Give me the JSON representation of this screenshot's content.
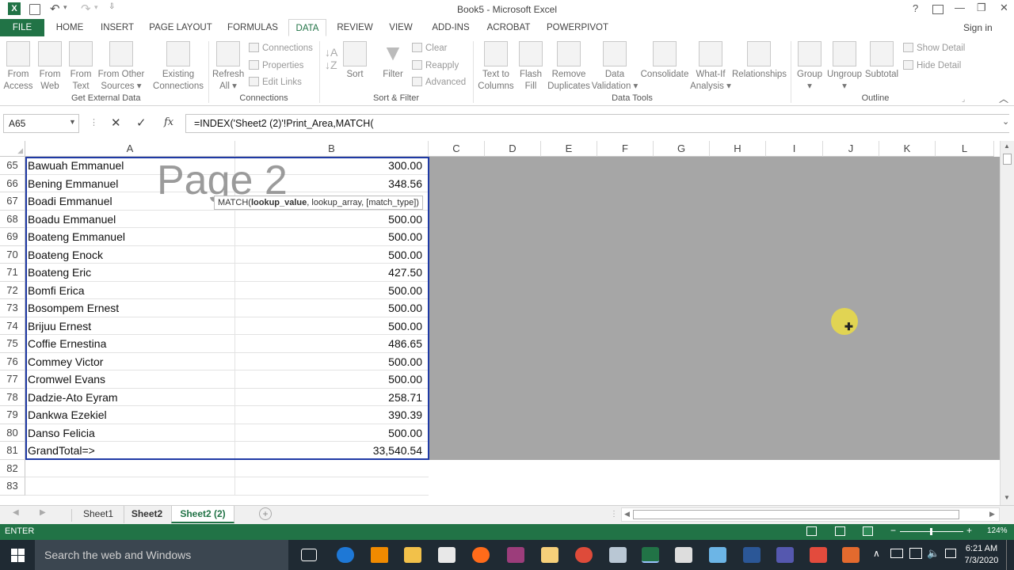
{
  "window": {
    "title": "Book5 - Microsoft Excel",
    "sign_in": "Sign in",
    "help": "?",
    "minimize": "—",
    "restore": "❐",
    "close": "✕"
  },
  "qat": {
    "save_icon": "save-icon",
    "undo_icon": "undo-icon",
    "redo_icon": "redo-icon"
  },
  "ribbon_tabs": [
    "FILE",
    "HOME",
    "INSERT",
    "PAGE LAYOUT",
    "FORMULAS",
    "DATA",
    "REVIEW",
    "VIEW",
    "ADD-INS",
    "ACROBAT",
    "POWERPIVOT"
  ],
  "active_tab": "DATA",
  "groups": {
    "get_external": {
      "label": "Get External Data",
      "buttons": [
        {
          "l1": "From",
          "l2": "Access"
        },
        {
          "l1": "From",
          "l2": "Web"
        },
        {
          "l1": "From",
          "l2": "Text"
        },
        {
          "l1": "From Other",
          "l2": "Sources ▾"
        },
        {
          "l1": "Existing",
          "l2": "Connections"
        }
      ]
    },
    "connections": {
      "label": "Connections",
      "refresh_l1": "Refresh",
      "refresh_l2": "All ▾",
      "items": [
        "Connections",
        "Properties",
        "Edit Links"
      ]
    },
    "sort_filter": {
      "label": "Sort & Filter",
      "sort": "Sort",
      "filter": "Filter",
      "items": [
        "Clear",
        "Reapply",
        "Advanced"
      ]
    },
    "data_tools": {
      "label": "Data Tools",
      "buttons": [
        {
          "l1": "Text to",
          "l2": "Columns"
        },
        {
          "l1": "Flash",
          "l2": "Fill"
        },
        {
          "l1": "Remove",
          "l2": "Duplicates"
        },
        {
          "l1": "Data",
          "l2": "Validation ▾"
        },
        {
          "l1": "Consolidate",
          "l2": ""
        },
        {
          "l1": "What-If",
          "l2": "Analysis ▾"
        },
        {
          "l1": "Relationships",
          "l2": ""
        }
      ]
    },
    "outline": {
      "label": "Outline",
      "buttons": [
        {
          "l1": "Group",
          "l2": "▾"
        },
        {
          "l1": "Ungroup",
          "l2": "▾"
        },
        {
          "l1": "Subtotal",
          "l2": ""
        }
      ],
      "items": [
        "Show Detail",
        "Hide Detail"
      ]
    }
  },
  "formula_bar": {
    "name_box": "A65",
    "cancel": "✕",
    "enter": "✓",
    "fx": "fx",
    "formula": "=INDEX('Sheet2 (2)'!Print_Area,MATCH(",
    "tooltip_fn": "MATCH(",
    "tooltip_arg1": "lookup_value",
    "tooltip_rest": ", lookup_array, [match_type])"
  },
  "columns": [
    "A",
    "B",
    "C",
    "D",
    "E",
    "F",
    "G",
    "H",
    "I",
    "J",
    "K",
    "L"
  ],
  "watermark": "Page 2",
  "rows": [
    {
      "n": "65",
      "a": "Bawuah Emmanuel",
      "b": "300.00"
    },
    {
      "n": "66",
      "a": "Bening Emmanuel",
      "b": "348.56"
    },
    {
      "n": "67",
      "a": "Boadi Emmanuel",
      "b": ""
    },
    {
      "n": "68",
      "a": "Boadu Emmanuel",
      "b": "500.00"
    },
    {
      "n": "69",
      "a": "Boateng Emmanuel",
      "b": "500.00"
    },
    {
      "n": "70",
      "a": "Boateng Enock",
      "b": "500.00"
    },
    {
      "n": "71",
      "a": "Boateng Eric",
      "b": "427.50"
    },
    {
      "n": "72",
      "a": "Bomfi Erica",
      "b": "500.00"
    },
    {
      "n": "73",
      "a": "Bosompem Ernest",
      "b": "500.00"
    },
    {
      "n": "74",
      "a": "Brijuu Ernest",
      "b": "500.00"
    },
    {
      "n": "75",
      "a": "Coffie Ernestina",
      "b": "486.65"
    },
    {
      "n": "76",
      "a": "Commey Victor",
      "b": "500.00"
    },
    {
      "n": "77",
      "a": "Cromwel Evans",
      "b": "500.00"
    },
    {
      "n": "78",
      "a": "Dadzie-Ato Eyram",
      "b": "258.71"
    },
    {
      "n": "79",
      "a": "Dankwa Ezekiel",
      "b": "390.39"
    },
    {
      "n": "80",
      "a": "Danso Felicia",
      "b": "500.00"
    },
    {
      "n": "81",
      "a": "GrandTotal=>",
      "b": "33,540.54"
    },
    {
      "n": "82",
      "a": "",
      "b": ""
    },
    {
      "n": "83",
      "a": "",
      "b": ""
    }
  ],
  "sheets": [
    "Sheet1",
    "Sheet2",
    "Sheet2 (2)"
  ],
  "active_sheet": "Sheet2 (2)",
  "status": {
    "mode": "ENTER",
    "zoom": "124%"
  },
  "taskbar": {
    "search_placeholder": "Search the web and Windows",
    "time": "6:21 AM",
    "date": "7/3/2020",
    "apps": [
      "task-view-icon",
      "edge-icon",
      "vlc-icon",
      "file-explorer-icon",
      "store-icon",
      "firefox-icon",
      "winrar-icon",
      "folder-icon",
      "chrome-icon",
      "network-icon",
      "excel-icon",
      "calculator-icon",
      "notepad-icon",
      "word-icon",
      "teams-icon",
      "acrobat-icon",
      "powerpoint-icon"
    ]
  },
  "colors": {
    "excel_green": "#217346",
    "grey_area": "#a6a6a6",
    "print_border": "#1f3aa5",
    "cursor_highlight": "#e8d94a"
  }
}
